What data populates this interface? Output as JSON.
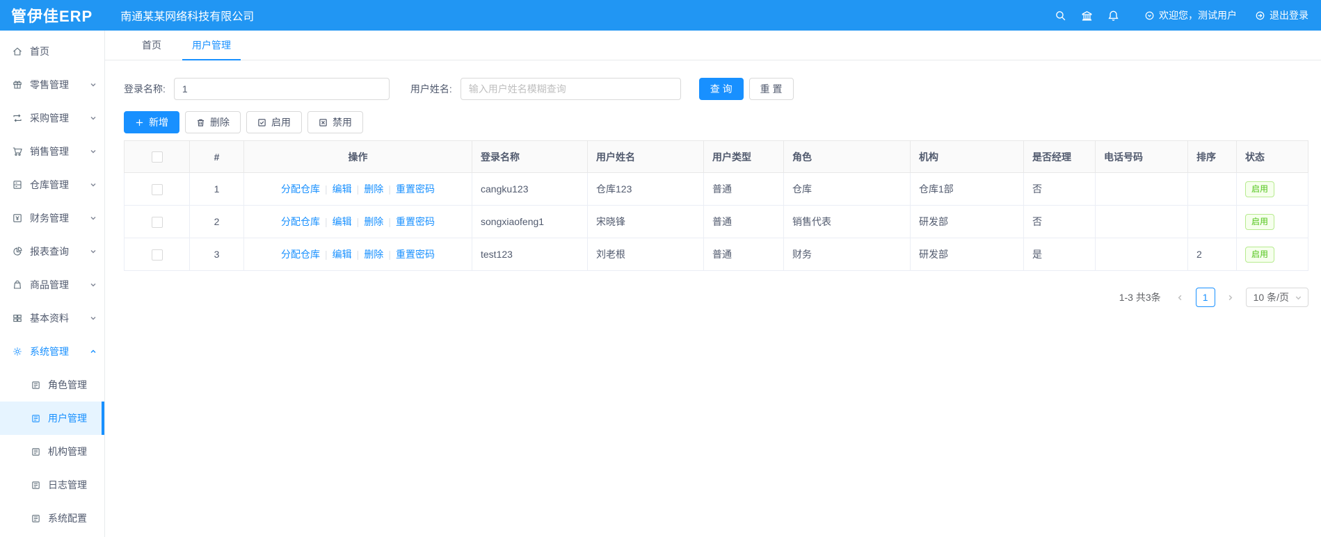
{
  "colors": {
    "primary": "#1890ff",
    "header_blue": "#2196f3",
    "success_green": "#52c41a"
  },
  "header": {
    "logo": "管伊佳ERP",
    "company": "南通某某网络科技有限公司",
    "welcome": "欢迎您，测试用户",
    "logout": "退出登录"
  },
  "sidebar": {
    "items": [
      {
        "label": "首页"
      },
      {
        "label": "零售管理"
      },
      {
        "label": "采购管理"
      },
      {
        "label": "销售管理"
      },
      {
        "label": "仓库管理"
      },
      {
        "label": "财务管理"
      },
      {
        "label": "报表查询"
      },
      {
        "label": "商品管理"
      },
      {
        "label": "基本资料"
      },
      {
        "label": "系统管理"
      }
    ],
    "system_children": [
      {
        "label": "角色管理"
      },
      {
        "label": "用户管理"
      },
      {
        "label": "机构管理"
      },
      {
        "label": "日志管理"
      },
      {
        "label": "系统配置"
      }
    ]
  },
  "tabs": [
    {
      "label": "首页"
    },
    {
      "label": "用户管理"
    }
  ],
  "filter": {
    "login_label": "登录名称:",
    "login_value": "1",
    "name_label": "用户姓名:",
    "name_placeholder": "输入用户姓名模糊查询",
    "search_label": "查 询",
    "reset_label": "重 置"
  },
  "toolbar": {
    "add_label": "新增",
    "delete_label": "删除",
    "enable_label": "启用",
    "disable_label": "禁用"
  },
  "table": {
    "headers": [
      "#",
      "操作",
      "登录名称",
      "用户姓名",
      "用户类型",
      "角色",
      "机构",
      "是否经理",
      "电话号码",
      "排序",
      "状态"
    ],
    "action_labels": [
      "分配仓库",
      "编辑",
      "删除",
      "重置密码"
    ],
    "rows": [
      {
        "index": "1",
        "login": "cangku123",
        "name": "仓库123",
        "type": "普通",
        "role": "仓库",
        "org": "仓库1部",
        "manager": "否",
        "phone": "",
        "sort": "",
        "status": "启用"
      },
      {
        "index": "2",
        "login": "songxiaofeng1",
        "name": "宋晓锋",
        "type": "普通",
        "role": "销售代表",
        "org": "研发部",
        "manager": "否",
        "phone": "",
        "sort": "",
        "status": "启用"
      },
      {
        "index": "3",
        "login": "test123",
        "name": "刘老根",
        "type": "普通",
        "role": "财务",
        "org": "研发部",
        "manager": "是",
        "phone": "",
        "sort": "2",
        "status": "启用"
      }
    ]
  },
  "pagination": {
    "total_text": "1-3 共3条",
    "current_page": "1",
    "page_size": "10 条/页"
  }
}
